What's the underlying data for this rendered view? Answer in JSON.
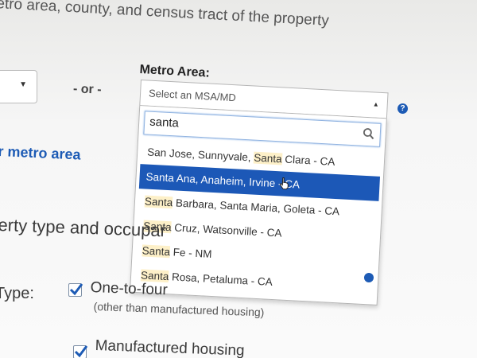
{
  "page": {
    "instruction_text": "etro area, county, and census tract of the property",
    "or_text": "- or -",
    "metro_link": "r metro area",
    "section_heading": "erty type and occupar",
    "type_label": "Type:"
  },
  "metro_area": {
    "label": "Metro Area:",
    "placeholder": "Select an MSA/MD",
    "help_icon": "question-icon",
    "search": {
      "value": "santa",
      "icon": "search-icon"
    },
    "options": [
      {
        "before": "San Jose, Sunnyvale, ",
        "match": "Santa",
        "after": " Clara - CA",
        "selected": false
      },
      {
        "before": "",
        "match": "Santa",
        "after": " Ana, Anaheim, Irvine - CA",
        "selected": true
      },
      {
        "before": "",
        "match": "Santa",
        "after": " Barbara, Santa Maria, Goleta - CA",
        "selected": false
      },
      {
        "before": "",
        "match": "Santa",
        "after": " Cruz, Watsonville - CA",
        "selected": false
      },
      {
        "before": "",
        "match": "Santa",
        "after": " Fe - NM",
        "selected": false
      },
      {
        "before": "",
        "match": "Santa",
        "after": " Rosa, Petaluma - CA",
        "selected": false
      }
    ]
  },
  "property_type": {
    "options": [
      {
        "label": "One-to-four",
        "sublabel": "(other than manufactured housing)",
        "checked": true
      },
      {
        "label": "Manufactured housing",
        "checked": true
      }
    ]
  },
  "colors": {
    "accent": "#1d5bb5",
    "selected_bg": "#1c58b7",
    "match_highlight": "#fdf0c8"
  }
}
